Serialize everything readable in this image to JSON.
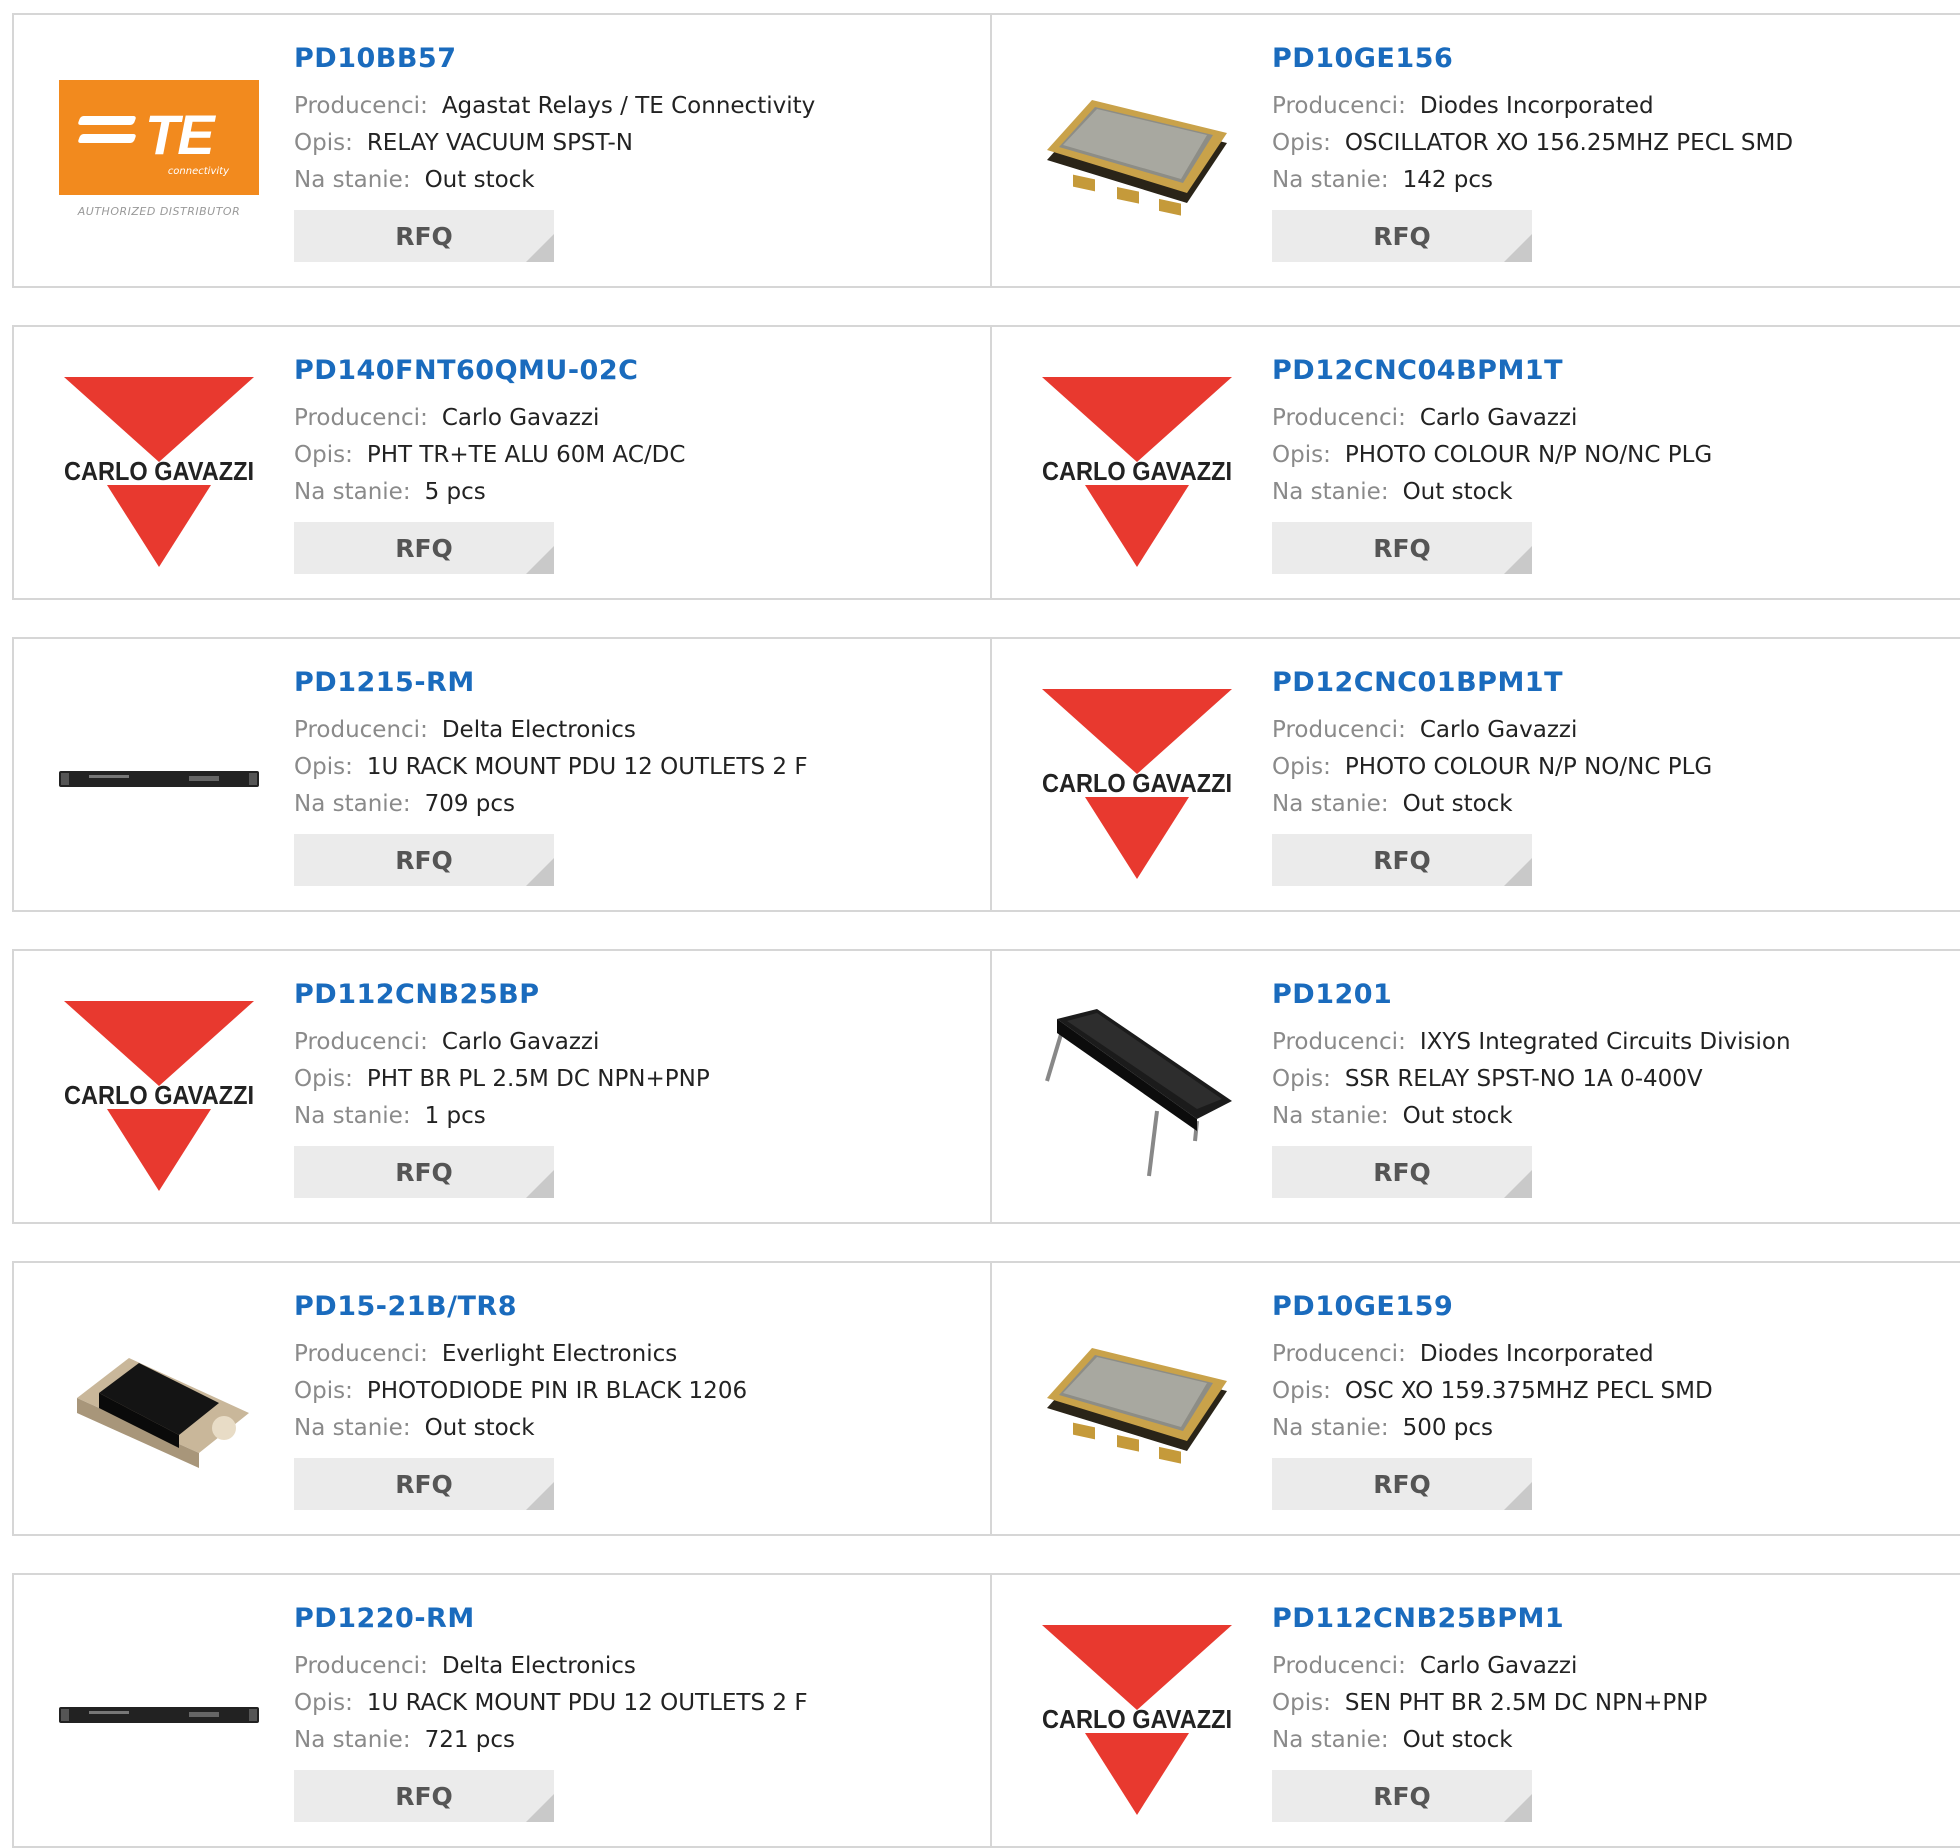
{
  "labels": {
    "manufacturer": "Producenci:",
    "description": "Opis:",
    "stock": "Na stanie:"
  },
  "rfq_label": "RFQ",
  "logos": {
    "te_letters": "TE",
    "te_sub": "connectivity",
    "te_caption": "AUTHORIZED DISTRIBUTOR",
    "carlo_gavazzi": "CARLO GAVAZZI"
  },
  "colors": {
    "link": "#1a6bbd",
    "te_orange": "#f28a1e",
    "cg_red": "#e8392f"
  },
  "products": [
    {
      "part": "PD10BB57",
      "manufacturer": "Agastat Relays / TE Connectivity",
      "description": "RELAY VACUUM SPST-N",
      "stock": "Out stock",
      "image": "te-logo"
    },
    {
      "part": "PD10GE156",
      "manufacturer": "Diodes Incorporated",
      "description": "OSCILLATOR XO 156.25MHZ PECL SMD",
      "stock": "142 pcs",
      "image": "oscillator-chip"
    },
    {
      "part": "PD140FNT60QMU-02C",
      "manufacturer": "Carlo Gavazzi",
      "description": "PHT TR+TE ALU 60M AC/DC",
      "stock": "5 pcs",
      "image": "carlo-gavazzi-logo"
    },
    {
      "part": "PD12CNC04BPM1T",
      "manufacturer": "Carlo Gavazzi",
      "description": "PHOTO COLOUR N/P NO/NC PLG",
      "stock": "Out stock",
      "image": "carlo-gavazzi-logo"
    },
    {
      "part": "PD1215-RM",
      "manufacturer": "Delta Electronics",
      "description": "1U RACK MOUNT PDU 12 OUTLETS 2 F",
      "stock": "709 pcs",
      "image": "rack-pdu"
    },
    {
      "part": "PD12CNC01BPM1T",
      "manufacturer": "Carlo Gavazzi",
      "description": "PHOTO COLOUR N/P NO/NC PLG",
      "stock": "Out stock",
      "image": "carlo-gavazzi-logo"
    },
    {
      "part": "PD112CNB25BP",
      "manufacturer": "Carlo Gavazzi",
      "description": "PHT BR PL 2.5M DC NPN+PNP",
      "stock": "1 pcs",
      "image": "carlo-gavazzi-logo"
    },
    {
      "part": "PD1201",
      "manufacturer": "IXYS Integrated Circuits Division",
      "description": "SSR RELAY SPST-NO 1A 0-400V",
      "stock": "Out stock",
      "image": "dip-relay"
    },
    {
      "part": "PD15-21B/TR8",
      "manufacturer": "Everlight Electronics",
      "description": "PHOTODIODE PIN IR BLACK 1206",
      "stock": "Out stock",
      "image": "photodiode"
    },
    {
      "part": "PD10GE159",
      "manufacturer": "Diodes Incorporated",
      "description": "OSC XO 159.375MHZ PECL SMD",
      "stock": "500 pcs",
      "image": "oscillator-chip"
    },
    {
      "part": "PD1220-RM",
      "manufacturer": "Delta Electronics",
      "description": "1U RACK MOUNT PDU 12 OUTLETS 2 F",
      "stock": "721 pcs",
      "image": "rack-pdu"
    },
    {
      "part": "PD112CNB25BPM1",
      "manufacturer": "Carlo Gavazzi",
      "description": "SEN PHT BR 2.5M DC NPN+PNP",
      "stock": "Out stock",
      "image": "carlo-gavazzi-logo"
    }
  ]
}
